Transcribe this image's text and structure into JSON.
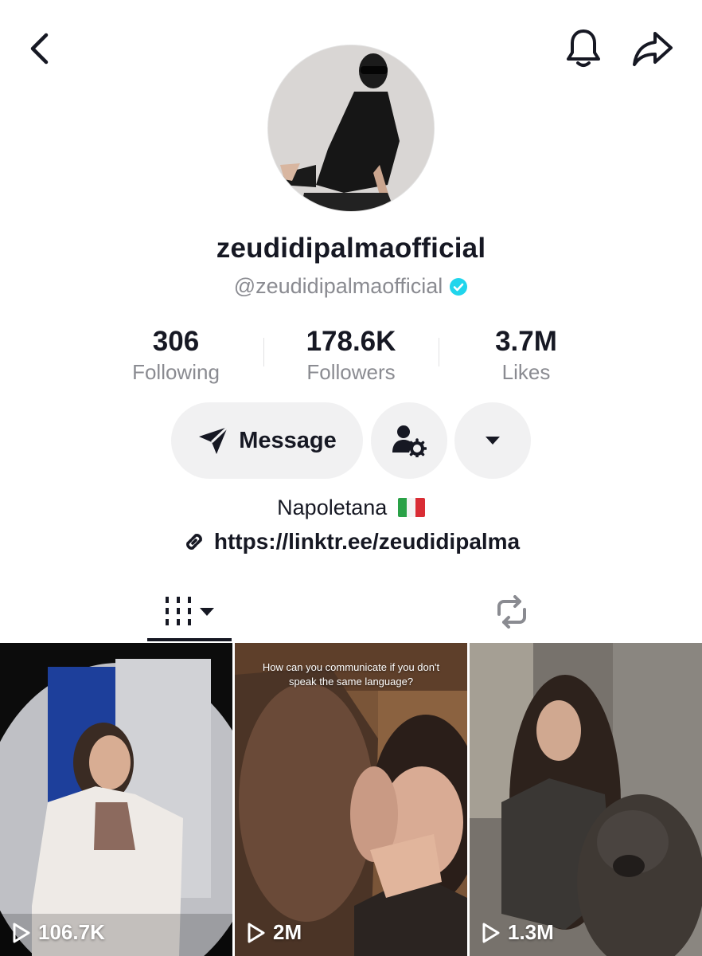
{
  "header": {
    "back_icon": "chevron-left-icon",
    "bell_icon": "bell-icon",
    "share_icon": "share-arrow-icon"
  },
  "profile": {
    "display_name": "zeudidipalmaofficial",
    "handle": "@zeudidipalmaofficial",
    "verified": true,
    "verified_color": "#20d5ec"
  },
  "stats": [
    {
      "value": "306",
      "label": "Following"
    },
    {
      "value": "178.6K",
      "label": "Followers"
    },
    {
      "value": "3.7M",
      "label": "Likes"
    }
  ],
  "actions": {
    "message_label": "Message",
    "message_icon": "send-icon",
    "add_friend_icon": "user-settings-icon",
    "more_icon": "caret-down-icon"
  },
  "bio": {
    "text": "Napoletana",
    "flag": "italy-flag",
    "link": "https://linktr.ee/zeudidipalma",
    "link_icon": "link-icon"
  },
  "tabs": [
    {
      "name": "videos",
      "icon": "grid-columns-icon",
      "selected": true
    },
    {
      "name": "reposts",
      "icon": "repost-icon",
      "selected": false
    }
  ],
  "videos": [
    {
      "views": "106.7K",
      "caption": ""
    },
    {
      "views": "2M",
      "caption": "How can you communicate if you don't speak the same language?"
    },
    {
      "views": "1.3M",
      "caption": ""
    }
  ]
}
